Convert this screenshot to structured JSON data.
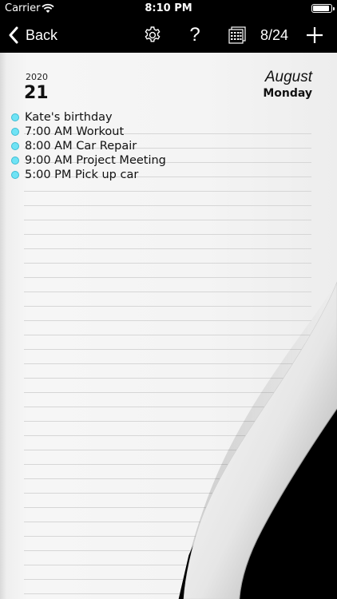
{
  "status": {
    "carrier": "Carrier",
    "time": "8:10 PM"
  },
  "nav": {
    "back_label": "Back",
    "help_label": "?",
    "page_counter": "8/24"
  },
  "page": {
    "year": "2020",
    "day": "21",
    "month": "August",
    "weekday": "Monday"
  },
  "events": [
    {
      "label": "Kate's birthday"
    },
    {
      "label": "7:00 AM Workout"
    },
    {
      "label": "8:00 AM Car Repair"
    },
    {
      "label": "9:00 AM Project Meeting"
    },
    {
      "label": "5:00 PM Pick up car"
    }
  ],
  "colors": {
    "accent_dot": "#6fe3f5",
    "bar_background": "#000000"
  }
}
